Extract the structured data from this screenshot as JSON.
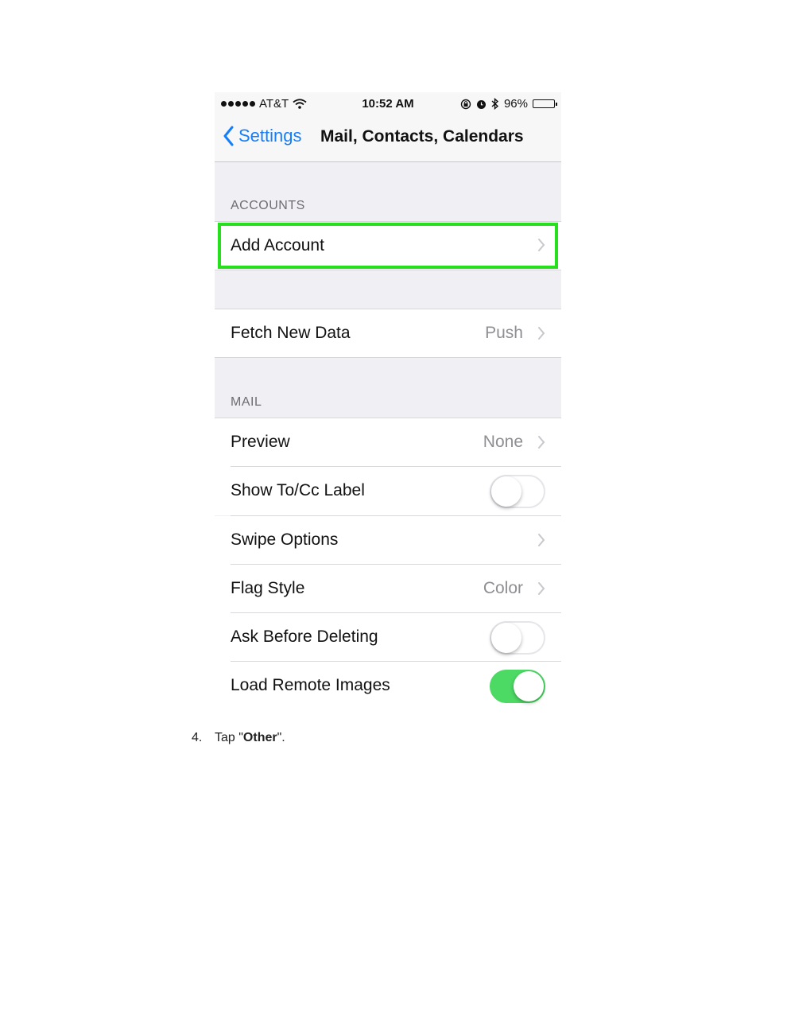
{
  "status_bar": {
    "carrier": "AT&T",
    "time": "10:52 AM",
    "battery": "96%",
    "battery_level": 0.96,
    "icons": [
      "signal-dots-icon",
      "wifi-icon",
      "orientation-lock-icon",
      "alarm-icon",
      "bluetooth-icon",
      "battery-icon"
    ]
  },
  "nav": {
    "back_label": "Settings",
    "title": "Mail, Contacts, Calendars"
  },
  "accounts": {
    "header": "ACCOUNTS",
    "add_account": "Add Account"
  },
  "fetch": {
    "label": "Fetch New Data",
    "value": "Push"
  },
  "mail": {
    "header": "MAIL",
    "preview": {
      "label": "Preview",
      "value": "None"
    },
    "show_tocc": {
      "label": "Show To/Cc Label",
      "on": false
    },
    "swipe": {
      "label": "Swipe Options"
    },
    "flag": {
      "label": "Flag Style",
      "value": "Color"
    },
    "ask_delete": {
      "label": "Ask Before Deleting",
      "on": false
    },
    "load_images": {
      "label": "Load Remote Images",
      "on": true
    }
  },
  "caption": {
    "number": "4.",
    "prefix": "Tap \"",
    "bold": "Other",
    "suffix": "\"."
  },
  "colors": {
    "ios_blue": "#147efb",
    "highlight_green": "#26e01d",
    "toggle_on": "#4cd964"
  }
}
